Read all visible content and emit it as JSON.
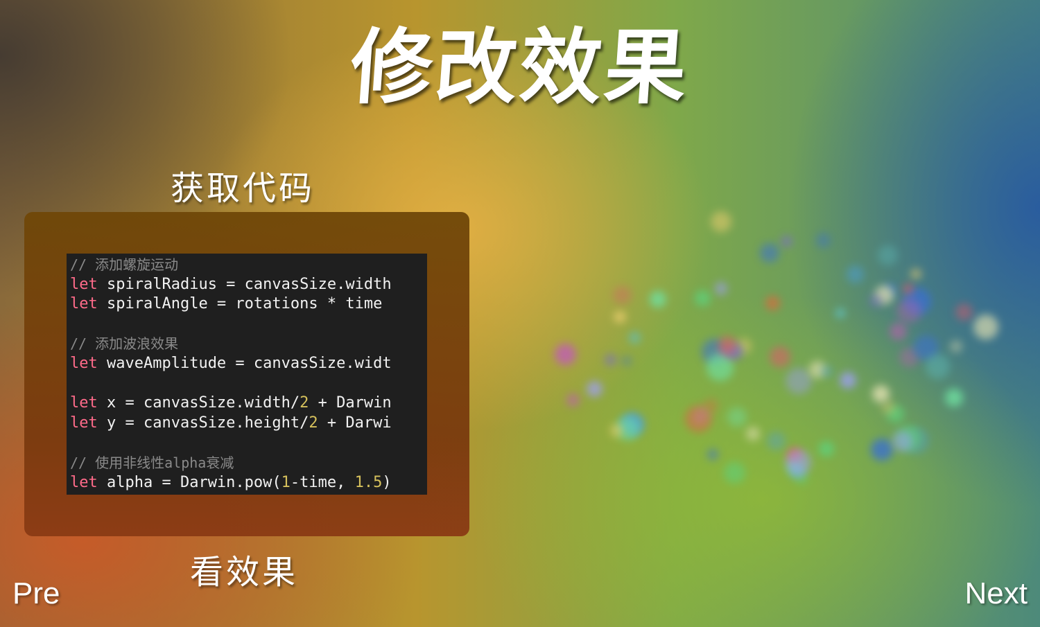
{
  "slide": {
    "title": "修改效果",
    "get_code_label": "获取代码",
    "see_effect_label": "看效果"
  },
  "code": {
    "lines": [
      [
        {
          "t": "// 添加螺旋运动",
          "k": "comment"
        }
      ],
      [
        {
          "t": "let",
          "k": "kw"
        },
        {
          "t": " spiralRadius = canvasSize.width",
          "k": "plain"
        }
      ],
      [
        {
          "t": "let",
          "k": "kw"
        },
        {
          "t": " spiralAngle = rotations * time ",
          "k": "plain"
        }
      ],
      [],
      [
        {
          "t": "// 添加波浪效果",
          "k": "comment"
        }
      ],
      [
        {
          "t": "let",
          "k": "kw"
        },
        {
          "t": " waveAmplitude = canvasSize.widt",
          "k": "plain"
        }
      ],
      [],
      [
        {
          "t": "let",
          "k": "kw"
        },
        {
          "t": " x = canvasSize.width/",
          "k": "plain"
        },
        {
          "t": "2",
          "k": "num"
        },
        {
          "t": " + Darwin",
          "k": "plain"
        }
      ],
      [
        {
          "t": "let",
          "k": "kw"
        },
        {
          "t": " y = canvasSize.height/",
          "k": "plain"
        },
        {
          "t": "2",
          "k": "num"
        },
        {
          "t": " + Darwi",
          "k": "plain"
        }
      ],
      [],
      [
        {
          "t": "// 使用非线性alpha衰减",
          "k": "comment"
        }
      ],
      [
        {
          "t": "let",
          "k": "kw"
        },
        {
          "t": " alpha = Darwin.pow(",
          "k": "plain"
        },
        {
          "t": "1",
          "k": "num"
        },
        {
          "t": "-time, ",
          "k": "plain"
        },
        {
          "t": "1.5",
          "k": "num"
        },
        {
          "t": ")",
          "k": "plain"
        }
      ]
    ]
  },
  "navigation": {
    "pre_label": "Pre",
    "next_label": "Next"
  },
  "colors": {
    "keyword": "#ff6b8a",
    "number": "#d6c15c",
    "comment": "#8a8a8a",
    "code_background": "#1f1f1f"
  }
}
